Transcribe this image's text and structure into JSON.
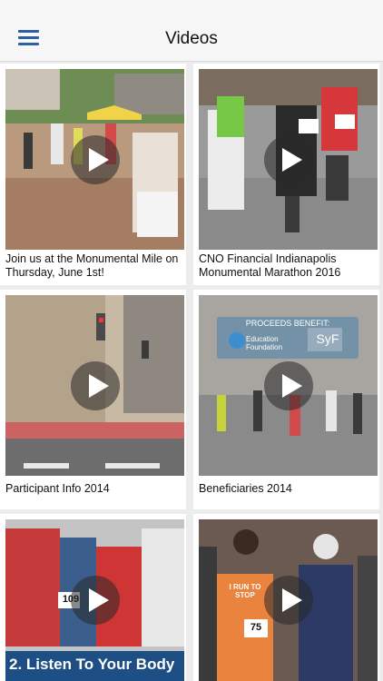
{
  "header": {
    "title": "Videos",
    "menu_icon": "hamburger-menu-icon"
  },
  "videos": [
    {
      "caption": "Join us at the Monumental Mile on Thursday, June 1st!"
    },
    {
      "caption": "CNO Financial Indianapolis Monumental Marathon 2016"
    },
    {
      "caption": "Participant Info 2014"
    },
    {
      "caption": "Beneficiaries 2014",
      "overlay": {
        "heading": "PROCEEDS BENEFIT:",
        "logo_left": "Education Foundation",
        "logo_right": "SyF"
      }
    },
    {
      "caption": "",
      "overlay": {
        "banner": "2. Listen To Your Body",
        "bib": "109"
      }
    },
    {
      "caption": "",
      "overlay": {
        "shirt_text": "I RUN TO STOP",
        "bib": "75"
      }
    }
  ],
  "colors": {
    "accent": "#2b5fa6",
    "background": "#ececec"
  }
}
